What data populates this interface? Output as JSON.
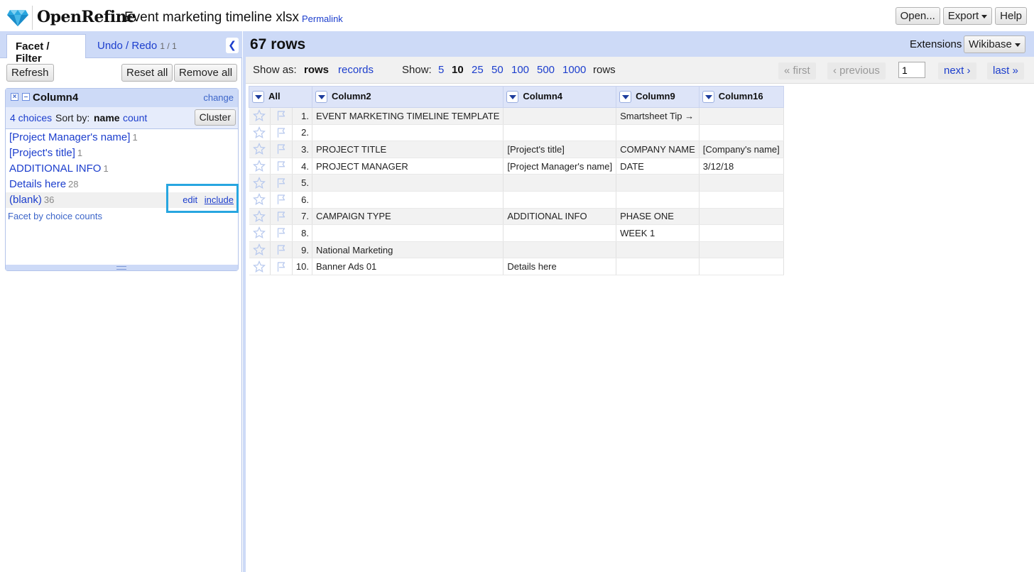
{
  "header": {
    "brand": "OpenRefine",
    "project_name": "Event marketing timeline xlsx",
    "permalink": "Permalink",
    "buttons": {
      "open": "Open...",
      "export": "Export",
      "help": "Help"
    }
  },
  "left_panel": {
    "tabs": {
      "facet": "Facet / Filter",
      "undo": "Undo / Redo",
      "undo_count": "1 / 1"
    },
    "controls": {
      "refresh": "Refresh",
      "reset_all": "Reset all",
      "remove_all": "Remove all"
    },
    "facet": {
      "name": "Column4",
      "change": "change",
      "choices_count": "4 choices",
      "sort_by": "Sort by:",
      "sort_name": "name",
      "sort_count": "count",
      "cluster": "Cluster",
      "choices": [
        {
          "label": "[Project Manager's name]",
          "count": "1"
        },
        {
          "label": "[Project's title]",
          "count": "1"
        },
        {
          "label": "ADDITIONAL INFO",
          "count": "1"
        },
        {
          "label": "Details here",
          "count": "28"
        },
        {
          "label": "(blank)",
          "count": "36"
        }
      ],
      "choice_actions": {
        "edit": "edit",
        "include": "include"
      },
      "facet_by_counts": "Facet by choice counts"
    }
  },
  "right_panel": {
    "row_count": "67 rows",
    "extensions_label": "Extensions",
    "wikibase": "Wikibase",
    "view": {
      "show_as": "Show as:",
      "rows": "rows",
      "records": "records",
      "show": "Show:",
      "page_sizes": [
        "5",
        "10",
        "25",
        "50",
        "100",
        "500",
        "1000"
      ],
      "active_page_size": "10",
      "rows_suffix": "rows"
    },
    "pager": {
      "first": "« first",
      "previous": "‹ previous",
      "page": "1",
      "next": "next ›",
      "last": "last »"
    },
    "table": {
      "columns": [
        "All",
        "Column2",
        "Column4",
        "Column9",
        "Column16"
      ],
      "rows": [
        [
          "1.",
          "EVENT MARKETING TIMELINE TEMPLATE",
          "",
          "Smartsheet Tip →",
          ""
        ],
        [
          "2.",
          "",
          "",
          "",
          ""
        ],
        [
          "3.",
          "PROJECT TITLE",
          "[Project's title]",
          "COMPANY NAME",
          "[Company's name]"
        ],
        [
          "4.",
          "PROJECT MANAGER",
          "[Project Manager's name]",
          "DATE",
          "3/12/18"
        ],
        [
          "5.",
          "",
          "",
          "",
          ""
        ],
        [
          "6.",
          "",
          "",
          "",
          ""
        ],
        [
          "7.",
          "CAMPAIGN TYPE",
          "ADDITIONAL INFO",
          "PHASE ONE",
          ""
        ],
        [
          "8.",
          "",
          "",
          "WEEK 1",
          ""
        ],
        [
          "9.",
          "National Marketing",
          "",
          "",
          ""
        ],
        [
          "10.",
          "Banner Ads 01",
          "Details here",
          "",
          ""
        ]
      ]
    }
  },
  "colors": {
    "accent_blue": "#1c3ecd",
    "panel_blue": "#cddaf7",
    "highlight_box": "#27a6e0",
    "logo_blue": "#2aa7e0"
  }
}
